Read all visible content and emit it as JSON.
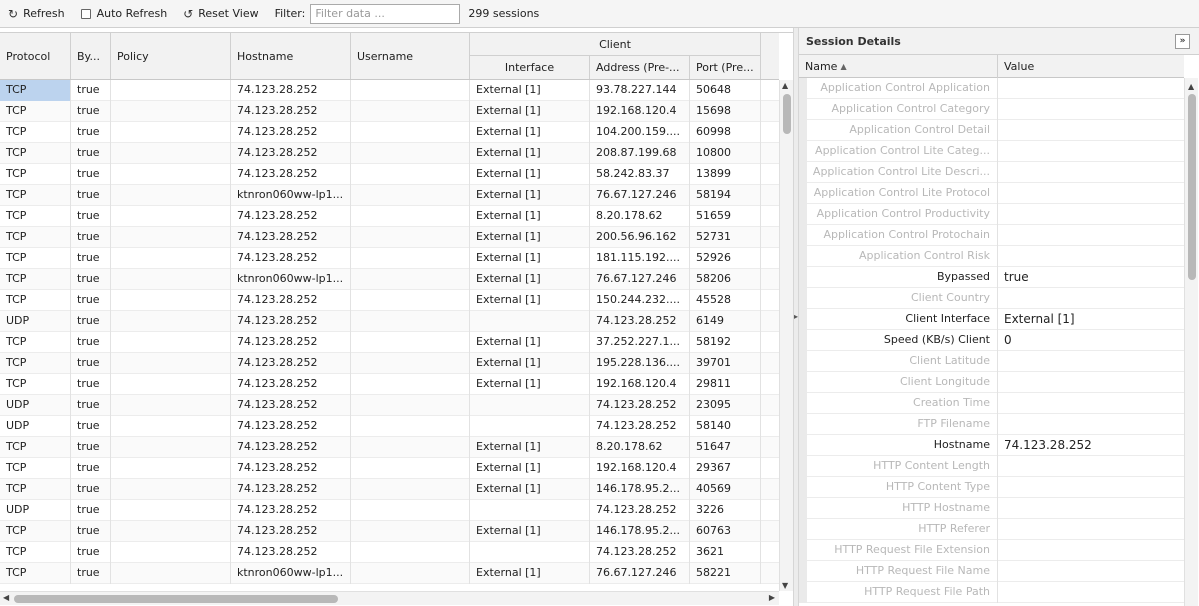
{
  "toolbar": {
    "refresh_label": "Refresh",
    "auto_refresh_label": "Auto Refresh",
    "reset_view_label": "Reset View",
    "filter_label": "Filter:",
    "filter_placeholder": "Filter data ...",
    "sessions_count": "299 sessions"
  },
  "grid": {
    "client_group": "Client",
    "columns": [
      "Protocol",
      "By...",
      "Policy",
      "Hostname",
      "Username",
      "Interface",
      "Address (Pre-...",
      "Port (Pre..."
    ],
    "rows": [
      [
        "TCP",
        "true",
        "",
        "74.123.28.252",
        "",
        "External [1]",
        "93.78.227.144",
        "50648"
      ],
      [
        "TCP",
        "true",
        "",
        "74.123.28.252",
        "",
        "External [1]",
        "192.168.120.4",
        "15698"
      ],
      [
        "TCP",
        "true",
        "",
        "74.123.28.252",
        "",
        "External [1]",
        "104.200.159....",
        "60998"
      ],
      [
        "TCP",
        "true",
        "",
        "74.123.28.252",
        "",
        "External [1]",
        "208.87.199.68",
        "10800"
      ],
      [
        "TCP",
        "true",
        "",
        "74.123.28.252",
        "",
        "External [1]",
        "58.242.83.37",
        "13899"
      ],
      [
        "TCP",
        "true",
        "",
        "ktnron060ww-lp1...",
        "",
        "External [1]",
        "76.67.127.246",
        "58194"
      ],
      [
        "TCP",
        "true",
        "",
        "74.123.28.252",
        "",
        "External [1]",
        "8.20.178.62",
        "51659"
      ],
      [
        "TCP",
        "true",
        "",
        "74.123.28.252",
        "",
        "External [1]",
        "200.56.96.162",
        "52731"
      ],
      [
        "TCP",
        "true",
        "",
        "74.123.28.252",
        "",
        "External [1]",
        "181.115.192....",
        "52926"
      ],
      [
        "TCP",
        "true",
        "",
        "ktnron060ww-lp1...",
        "",
        "External [1]",
        "76.67.127.246",
        "58206"
      ],
      [
        "TCP",
        "true",
        "",
        "74.123.28.252",
        "",
        "External [1]",
        "150.244.232....",
        "45528"
      ],
      [
        "UDP",
        "true",
        "",
        "74.123.28.252",
        "",
        "",
        "74.123.28.252",
        "6149"
      ],
      [
        "TCP",
        "true",
        "",
        "74.123.28.252",
        "",
        "External [1]",
        "37.252.227.1...",
        "58192"
      ],
      [
        "TCP",
        "true",
        "",
        "74.123.28.252",
        "",
        "External [1]",
        "195.228.136....",
        "39701"
      ],
      [
        "TCP",
        "true",
        "",
        "74.123.28.252",
        "",
        "External [1]",
        "192.168.120.4",
        "29811"
      ],
      [
        "UDP",
        "true",
        "",
        "74.123.28.252",
        "",
        "",
        "74.123.28.252",
        "23095"
      ],
      [
        "UDP",
        "true",
        "",
        "74.123.28.252",
        "",
        "",
        "74.123.28.252",
        "58140"
      ],
      [
        "TCP",
        "true",
        "",
        "74.123.28.252",
        "",
        "External [1]",
        "8.20.178.62",
        "51647"
      ],
      [
        "TCP",
        "true",
        "",
        "74.123.28.252",
        "",
        "External [1]",
        "192.168.120.4",
        "29367"
      ],
      [
        "TCP",
        "true",
        "",
        "74.123.28.252",
        "",
        "External [1]",
        "146.178.95.2...",
        "40569"
      ],
      [
        "UDP",
        "true",
        "",
        "74.123.28.252",
        "",
        "",
        "74.123.28.252",
        "3226"
      ],
      [
        "TCP",
        "true",
        "",
        "74.123.28.252",
        "",
        "External [1]",
        "146.178.95.2...",
        "60763"
      ],
      [
        "TCP",
        "true",
        "",
        "74.123.28.252",
        "",
        "",
        "74.123.28.252",
        "3621"
      ],
      [
        "TCP",
        "true",
        "",
        "ktnron060ww-lp1...",
        "",
        "External [1]",
        "76.67.127.246",
        "58221"
      ]
    ]
  },
  "panel": {
    "title": "Session Details",
    "name_header": "Name",
    "value_header": "Value",
    "rows": [
      {
        "name": "Application Control Application",
        "value": "",
        "active": false
      },
      {
        "name": "Application Control Category",
        "value": "",
        "active": false
      },
      {
        "name": "Application Control Detail",
        "value": "",
        "active": false
      },
      {
        "name": "Application Control Lite Categ...",
        "value": "",
        "active": false
      },
      {
        "name": "Application Control Lite Descri...",
        "value": "",
        "active": false
      },
      {
        "name": "Application Control Lite Protocol",
        "value": "",
        "active": false
      },
      {
        "name": "Application Control Productivity",
        "value": "",
        "active": false
      },
      {
        "name": "Application Control Protochain",
        "value": "",
        "active": false
      },
      {
        "name": "Application Control Risk",
        "value": "",
        "active": false
      },
      {
        "name": "Bypassed",
        "value": "true",
        "active": true
      },
      {
        "name": "Client Country",
        "value": "",
        "active": false
      },
      {
        "name": "Client Interface",
        "value": "External [1]",
        "active": true
      },
      {
        "name": "Speed (KB/s) Client",
        "value": "0",
        "active": true
      },
      {
        "name": "Client Latitude",
        "value": "",
        "active": false
      },
      {
        "name": "Client Longitude",
        "value": "",
        "active": false
      },
      {
        "name": "Creation Time",
        "value": "",
        "active": false
      },
      {
        "name": "FTP Filename",
        "value": "",
        "active": false
      },
      {
        "name": "Hostname",
        "value": "74.123.28.252",
        "active": true
      },
      {
        "name": "HTTP Content Length",
        "value": "",
        "active": false
      },
      {
        "name": "HTTP Content Type",
        "value": "",
        "active": false
      },
      {
        "name": "HTTP Hostname",
        "value": "",
        "active": false
      },
      {
        "name": "HTTP Referer",
        "value": "",
        "active": false
      },
      {
        "name": "HTTP Request File Extension",
        "value": "",
        "active": false
      },
      {
        "name": "HTTP Request File Name",
        "value": "",
        "active": false
      },
      {
        "name": "HTTP Request File Path",
        "value": "",
        "active": false
      }
    ]
  },
  "icons": {
    "refresh": "refresh-icon",
    "reset_view": "reset-view-icon",
    "collapse": "collapse-panel-icon",
    "sort_asc": "sort-ascending-icon"
  }
}
